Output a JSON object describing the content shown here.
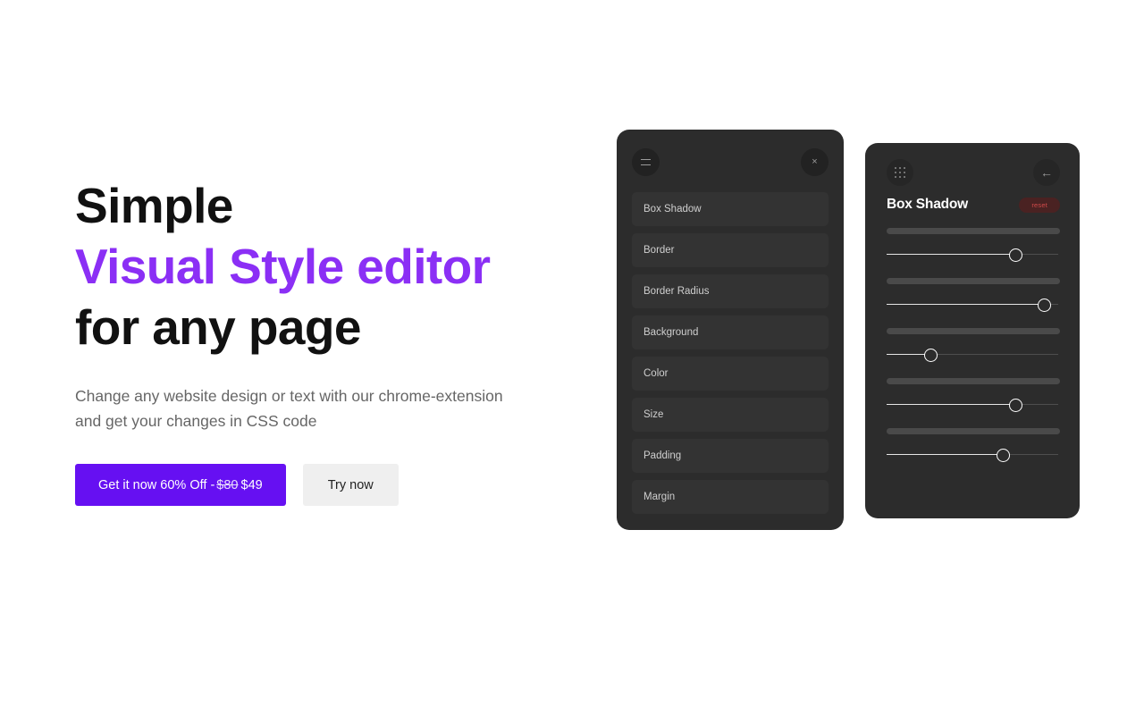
{
  "hero": {
    "title_line1": "Simple",
    "title_line2": "Visual Style editor",
    "title_line3": "for any page",
    "subtitle": "Change any website design or text with our chrome-extension and get your changes in CSS code",
    "primary_cta": {
      "prefix": "Get it now 60% Off -",
      "old_price": "$80",
      "new_price": "$49"
    },
    "secondary_cta": "Try now",
    "accent_color": "#8b2ff5",
    "primary_button_color": "#6610f2",
    "secondary_button_color": "#efefef"
  },
  "menu_panel": {
    "drag_icon": "hamburger-icon",
    "close_icon": "close-icon",
    "close_label": "×",
    "background_color": "#2c2c2c",
    "item_color": "#333333",
    "items": [
      {
        "label": "Box Shadow"
      },
      {
        "label": "Border"
      },
      {
        "label": "Border Radius"
      },
      {
        "label": "Background"
      },
      {
        "label": "Color"
      },
      {
        "label": "Size"
      },
      {
        "label": "Padding"
      },
      {
        "label": "Margin"
      }
    ]
  },
  "slider_panel": {
    "drag_icon": "drag-dots-icon",
    "back_icon": "back-arrow-icon",
    "back_label": "←",
    "title": "Box Shadow",
    "reset_label": "reset",
    "reset_bg_color": "#4a2222",
    "reset_text_color": "#d24a4a",
    "background_color": "#2c2c2c",
    "sliders": [
      {
        "value": 75
      },
      {
        "value": 92
      },
      {
        "value": 26
      },
      {
        "value": 75
      },
      {
        "value": 68
      }
    ]
  }
}
